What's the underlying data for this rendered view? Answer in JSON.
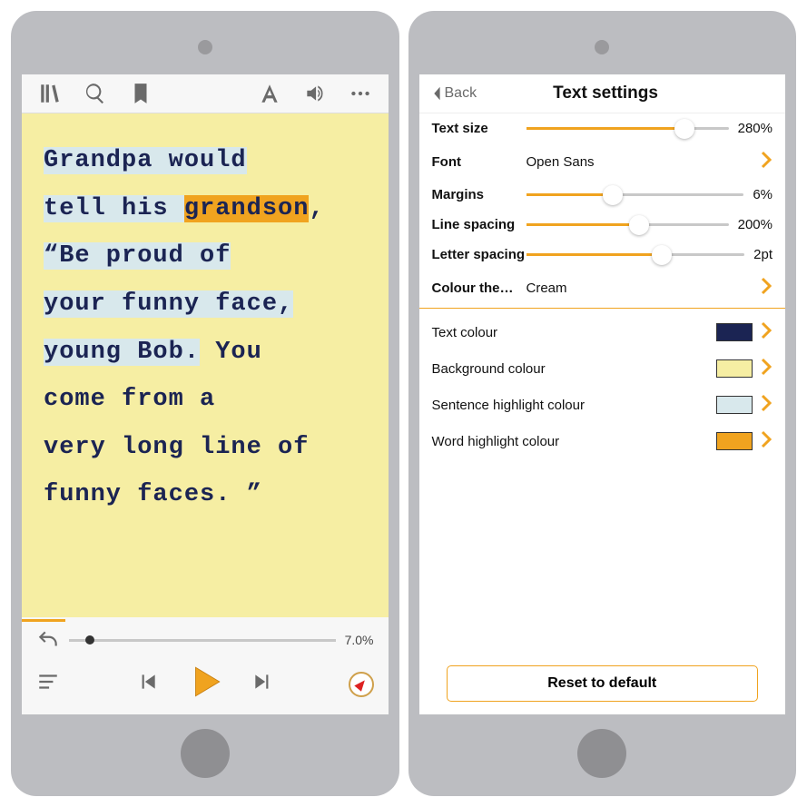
{
  "colors": {
    "accent": "#f0a31f",
    "text_ink": "#1b2453",
    "page_bg": "#f6eea3",
    "sentence_hl": "#d8e8ec",
    "word_hl": "#f0a31f"
  },
  "reader": {
    "line1_a": "Grandpa would",
    "line2_a": "tell his ",
    "line2_word": "grandson",
    "line2_b": ",",
    "line3": "“Be proud of",
    "line4": "your funny face,",
    "line5": "young Bob.",
    "line6": " You",
    "line7": "come from a",
    "line8": "very long line of",
    "line9": "funny faces. ”",
    "progress_pct": "7.0%"
  },
  "settings": {
    "title": "Text settings",
    "back": "Back",
    "rows": {
      "text_size": {
        "label": "Text size",
        "value": "280%",
        "pct": 78
      },
      "font": {
        "label": "Font",
        "value": "Open Sans"
      },
      "margins": {
        "label": "Margins",
        "value": "6%",
        "pct": 40
      },
      "line_spacing": {
        "label": "Line spacing",
        "value": "200%",
        "pct": 56
      },
      "letter_spacing": {
        "label": "Letter spacing",
        "value": "2pt",
        "pct": 62
      },
      "colour_theme": {
        "label": "Colour the…",
        "value": "Cream"
      },
      "text_colour": {
        "label": "Text colour",
        "swatch": "#1b2453"
      },
      "background_colour": {
        "label": "Background colour",
        "swatch": "#f6eea3"
      },
      "sentence_hl": {
        "label": "Sentence highlight colour",
        "swatch": "#d8e8ec"
      },
      "word_hl": {
        "label": "Word highlight colour",
        "swatch": "#f0a31f"
      }
    },
    "reset": "Reset to default"
  }
}
